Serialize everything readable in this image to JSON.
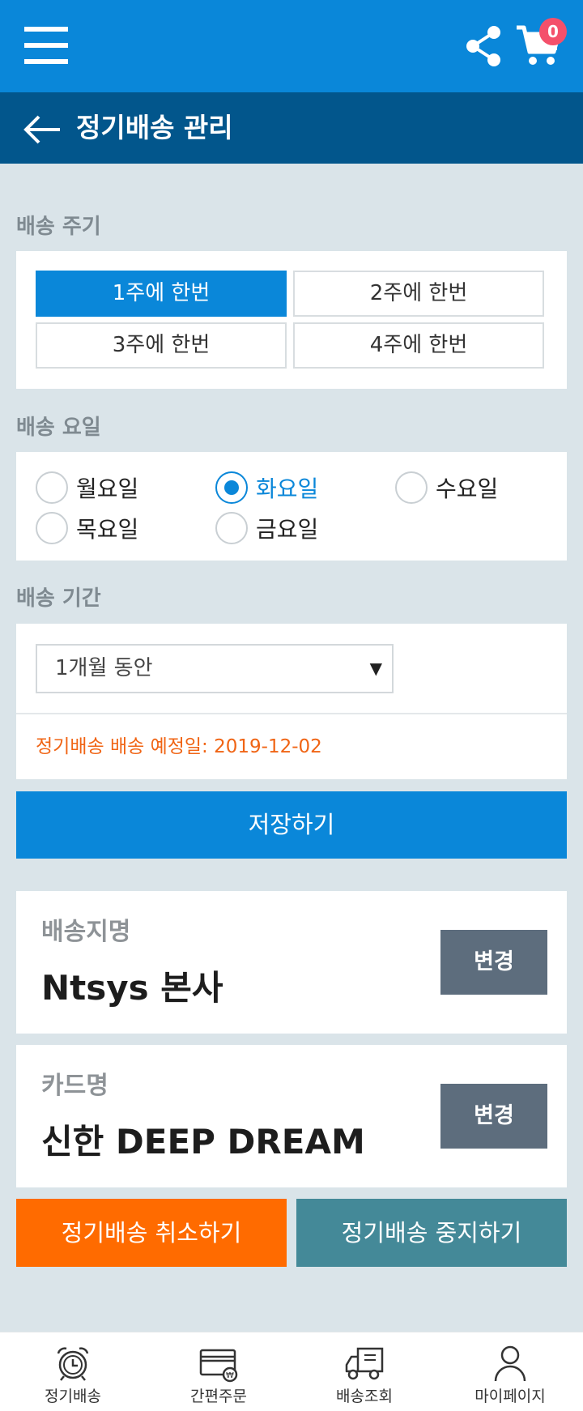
{
  "header": {
    "cart_count": "0",
    "menu_icon": "hamburger-menu-icon",
    "share_icon": "share-icon",
    "cart_icon": "shopping-cart-icon"
  },
  "titlebar": {
    "title": "정기배송 관리",
    "back_icon": "back-arrow-icon"
  },
  "frequency": {
    "label": "배송 주기",
    "options": [
      "1주에 한번",
      "2주에 한번",
      "3주에 한번",
      "4주에 한번"
    ],
    "selected": "1주에 한번"
  },
  "weekday": {
    "label": "배송 요일",
    "options": [
      "월요일",
      "화요일",
      "수요일",
      "목요일",
      "금요일"
    ],
    "selected": "화요일"
  },
  "period": {
    "label": "배송 기간",
    "selected": "1개월 동안",
    "arrow": "▼",
    "due_date": "정기배송 배송 예정일: 2019-12-02"
  },
  "save_label": "저장하기",
  "address": {
    "label": "배송지명",
    "value": "Ntsys 본사",
    "change_label": "변경"
  },
  "card": {
    "label": "카드명",
    "value": "신한 DEEP DREAM",
    "change_label": "변경"
  },
  "actions": {
    "cancel_label": "정기배송 취소하기",
    "pause_label": "정기배송 중지하기"
  },
  "bottom_nav": [
    {
      "label": "정기배송",
      "icon": "alarm-clock-icon"
    },
    {
      "label": "간편주문",
      "icon": "card-payment-icon"
    },
    {
      "label": "배송조회",
      "icon": "delivery-truck-icon"
    },
    {
      "label": "마이페이지",
      "icon": "user-icon"
    }
  ],
  "colors": {
    "primary": "#0a87d9",
    "title_bar": "#02568c",
    "background": "#dae4e9",
    "accent_orange": "#ff6b00",
    "accent_teal": "#448998",
    "change_button": "#5d6d7d",
    "badge": "#f4506b",
    "due_date_text": "#f06414"
  }
}
